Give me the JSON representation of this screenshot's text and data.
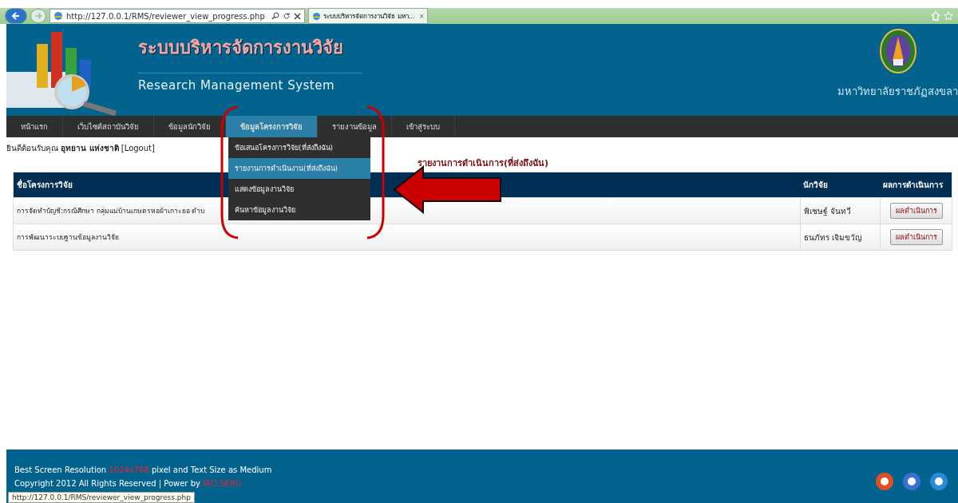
{
  "browser": {
    "url": "http://127.0.0.1/RMS/reviewer_view_progress.php",
    "tab_title": "ระบบบริหารจัดการงานวิจัย มหา...",
    "tab_close": "×"
  },
  "header": {
    "title_th": "ระบบบริหารจัดการงานวิจัย",
    "title_en": "Research Management System",
    "university": "มหาวิทยาลัยราชภัฏสงขลา"
  },
  "nav": [
    {
      "label": "หน้าแรก",
      "selected": false
    },
    {
      "label": "เว็บไซต์สถาบันวิจัย",
      "selected": false
    },
    {
      "label": "ข้อมูลนักวิจัย",
      "selected": false
    },
    {
      "label": "ข้อมูลโครงการวิจัย",
      "selected": true
    },
    {
      "label": "รายงานข้อมูล",
      "selected": false
    },
    {
      "label": "เข้าสู่ระบบ",
      "selected": false
    }
  ],
  "dropdown": [
    {
      "label": "ข้อเสนอโครงการวิจัย(ที่ส่งถึงฉัน)",
      "selected": false
    },
    {
      "label": "รายงานการดำเนินงาน(ที่ส่งถึงฉัน)",
      "selected": true
    },
    {
      "label": "แสดงข้อมูลงานวิจัย",
      "selected": false
    },
    {
      "label": "ค้นหาข้อมูลงานวิจัย",
      "selected": false
    }
  ],
  "welcome": {
    "prefix": "ยินดีต้อนรับคุณ",
    "name": "อุทยาน แห่งชาติ",
    "logout": "[Logout]"
  },
  "page_title": "รายงานการดำเนินการ(ที่ส่งถึงฉัน)",
  "table": {
    "columns": [
      "ชื่อโครงการวิจัย",
      "นักวิจัย",
      "ผลการดำเนินการ"
    ],
    "rows": [
      {
        "project": "การจัดทำบัญชี:กรณีศึกษา กลุ่มแม่บ้านเกษตรหอผ้าเกาะยอ ตำบ",
        "researcher": "พิเชษฐ์ จันทวี",
        "action": "ผลดำเนินการ"
      },
      {
        "project": "การพัฒนาระบบฐานข้อมูลงานวิจัย",
        "researcher": "ธนภัทร เจิมขวัญ",
        "action": "ผลดำเนินการ"
      }
    ]
  },
  "footer": {
    "resolution_prefix": "Best Screen Resolution",
    "resolution": "1024x768",
    "resolution_suffix": "pixel and Text Size as Medium",
    "copyright": "Copyright 2012 All Rights Reserved | Power by",
    "credit": "IRD.SKRU"
  },
  "status_bar": {
    "url": "http://127.0.0.1/RMS/reviewer_view_progress.php"
  }
}
